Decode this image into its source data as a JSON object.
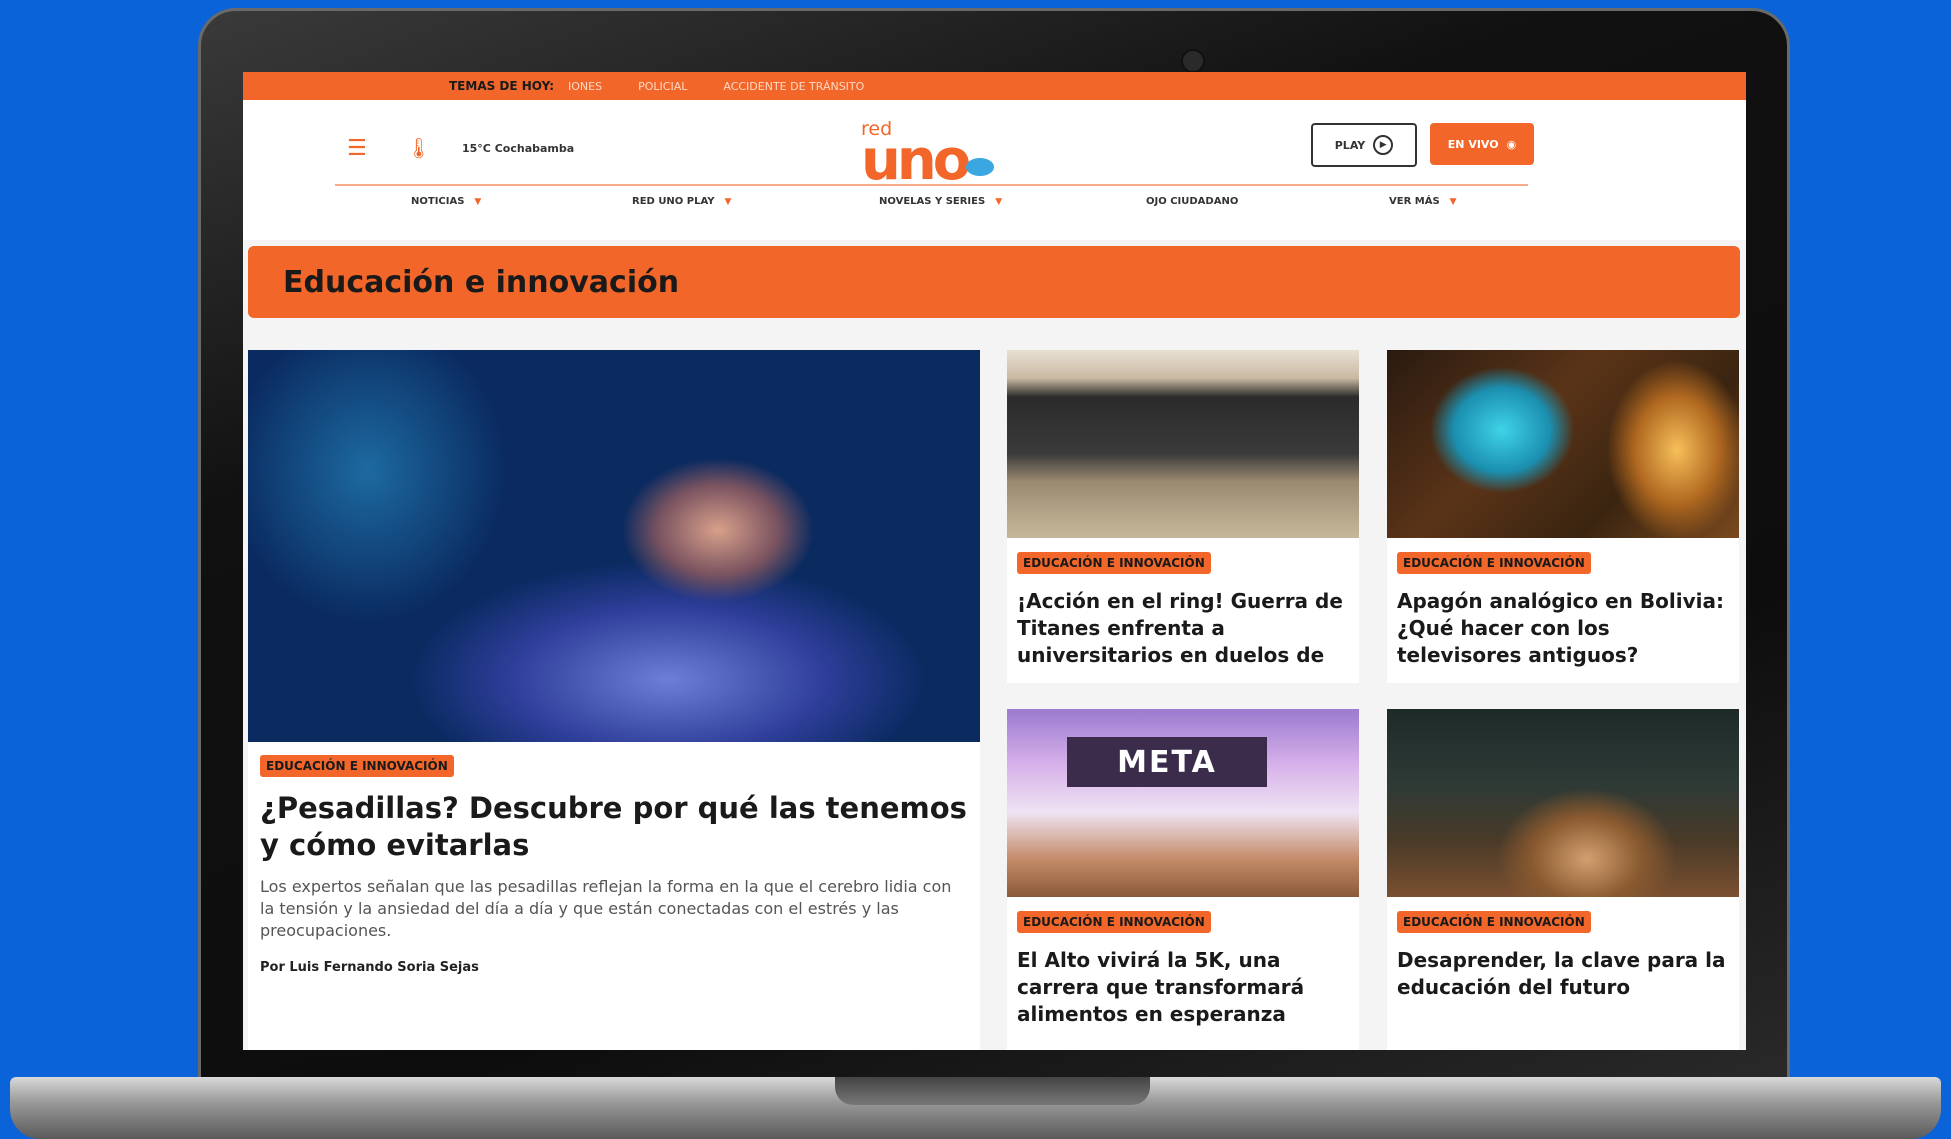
{
  "topics_bar": {
    "label": "TEMAS DE HOY:",
    "items": [
      "IONES",
      "POLICIAL",
      "ACCIDENTE DE TRÁNSITO"
    ]
  },
  "header": {
    "weather": "15°C Cochabamba",
    "logo_small": "red",
    "logo_main": "uno",
    "play_label": "PLAY",
    "live_label": "EN VIVO"
  },
  "nav": [
    {
      "label": "NOTICIAS"
    },
    {
      "label": "RED UNO PLAY"
    },
    {
      "label": "NOVELAS Y SERIES"
    },
    {
      "label": "OJO CIUDADANO"
    },
    {
      "label": "VER MÁS"
    }
  ],
  "section": {
    "title": "Educación e innovación"
  },
  "featured": {
    "tag": "EDUCACIÓN E INNOVACIÓN",
    "title": "¿Pesadillas? Descubre por qué las tenemos y cómo evitarlas",
    "summary": "Los expertos señalan que las pesadillas reflejan la forma en la que el cerebro lidia con la tensión y la ansiedad del día a día y que están conectadas con el estrés y las preocupaciones.",
    "author": "Por  Luis Fernando Soria Sejas"
  },
  "cards": [
    {
      "tag": "EDUCACIÓN E INNOVACIÓN",
      "title": "¡Acción en el ring! Guerra de Titanes enfrenta a universitarios en duelos de"
    },
    {
      "tag": "EDUCACIÓN E INNOVACIÓN",
      "title": "Apagón analógico en Bolivia: ¿Qué hacer con los televisores antiguos?"
    },
    {
      "tag": "EDUCACIÓN E INNOVACIÓN",
      "title": "El Alto vivirá la 5K, una carrera que transformará alimentos en esperanza",
      "image_text": "META"
    },
    {
      "tag": "EDUCACIÓN E INNOVACIÓN",
      "title": "Desaprender, la clave para la educación del futuro"
    }
  ],
  "colors": {
    "accent": "#f2662a",
    "background": "#0a63d9",
    "logo_dot": "#3aa7e0"
  }
}
